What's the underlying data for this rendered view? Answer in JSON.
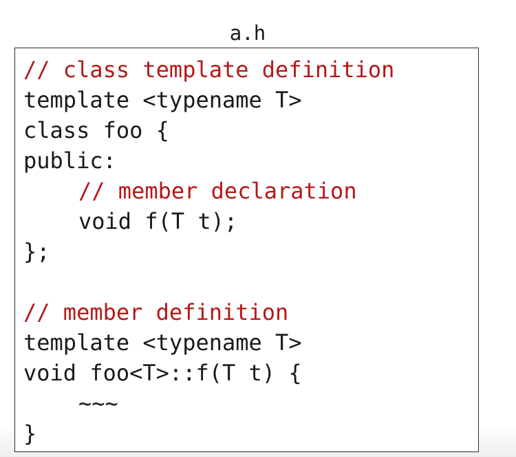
{
  "file_name": "a.h",
  "colors": {
    "code_text": "#1a1a1a",
    "comment_text": "#b51818",
    "box_border": "#2b2b2b"
  },
  "code_lines": [
    {
      "text": "// class template definition",
      "type": "comment"
    },
    {
      "text": "template <typename T>",
      "type": "code"
    },
    {
      "text": "class foo {",
      "type": "code"
    },
    {
      "text": "public:",
      "type": "code"
    },
    {
      "text": "// member declaration",
      "type": "comment"
    },
    {
      "text": "void f(T t);",
      "type": "code"
    },
    {
      "text": "};",
      "type": "code"
    },
    {
      "text": "",
      "type": "blank"
    },
    {
      "text": "// member definition",
      "type": "comment"
    },
    {
      "text": "template <typename T>",
      "type": "code"
    },
    {
      "text": "void foo<T>::f(T t) {",
      "type": "code"
    },
    {
      "text": "~~~",
      "type": "code"
    },
    {
      "text": "}",
      "type": "code"
    }
  ]
}
